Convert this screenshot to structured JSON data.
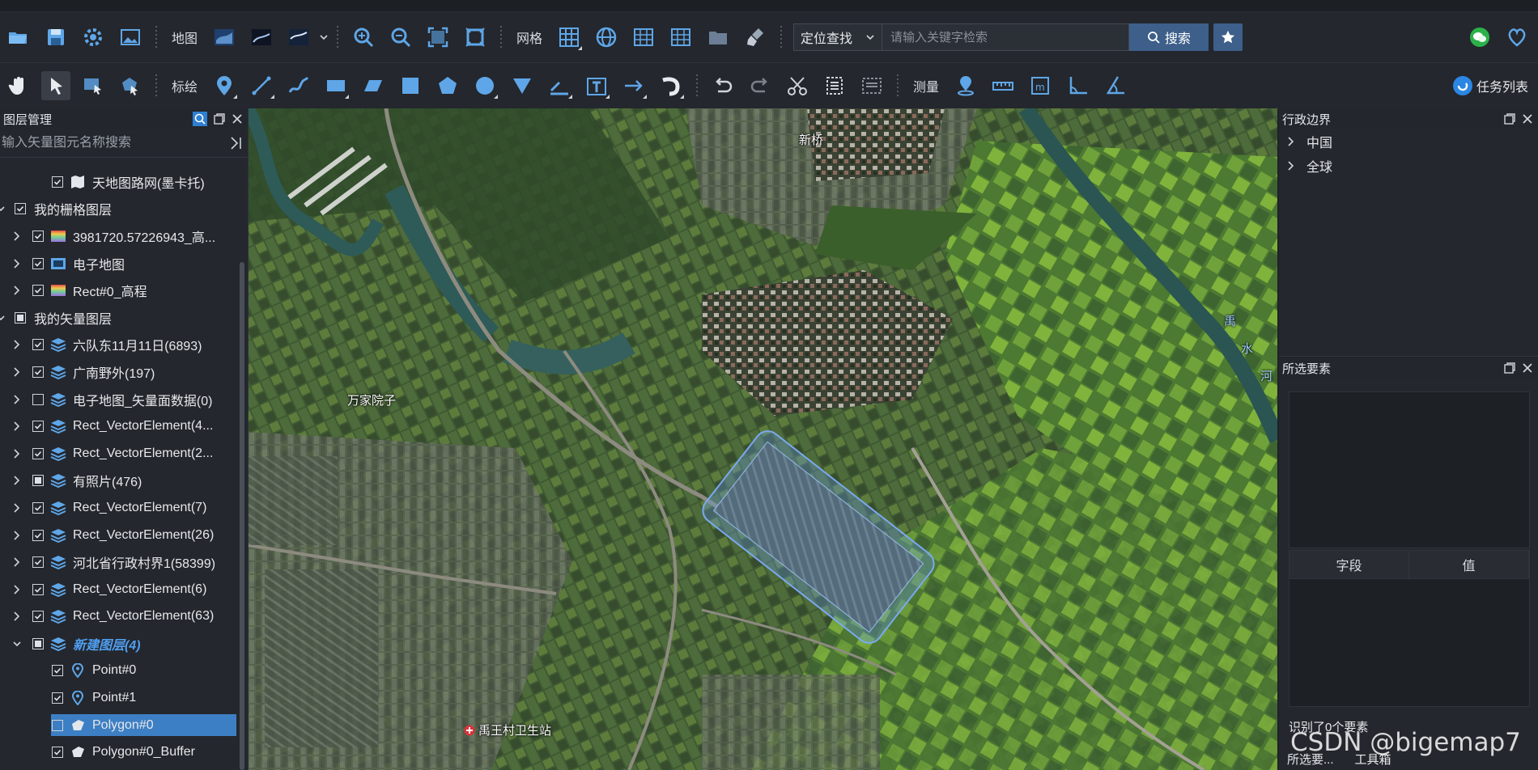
{
  "toolbar1": {
    "map_label": "地图",
    "grid_label": "网格",
    "location_select": "定位查找",
    "search_placeholder": "请输入关键字检索",
    "search_button": "搜索"
  },
  "toolbar2": {
    "draw_label": "标绘",
    "measure_label": "测量",
    "task_list": "任务列表"
  },
  "left_panel": {
    "title": "图层管理",
    "search_placeholder": "输入矢量图元名称搜索",
    "layers": [
      {
        "name": "天地图路网(墨卡托)",
        "level": 2,
        "expander": "none",
        "check": "checked",
        "icon": "map-book"
      },
      {
        "name": "我的栅格图层",
        "level": 0,
        "expander": "down",
        "check": "checked",
        "icon": "none"
      },
      {
        "name": "3981720.57226943_高...",
        "level": 1,
        "expander": "right",
        "check": "checked",
        "icon": "gradient"
      },
      {
        "name": "电子地图",
        "level": 1,
        "expander": "right",
        "check": "checked",
        "icon": "image"
      },
      {
        "name": "Rect#0_高程",
        "level": 1,
        "expander": "right",
        "check": "checked",
        "icon": "gradient"
      },
      {
        "name": "我的矢量图层",
        "level": 0,
        "expander": "down",
        "check": "partial",
        "icon": "none"
      },
      {
        "name": "六队东11月11日(6893)",
        "level": 1,
        "expander": "right",
        "check": "checked",
        "icon": "layers"
      },
      {
        "name": "广南野外(197)",
        "level": 1,
        "expander": "right",
        "check": "checked",
        "icon": "layers"
      },
      {
        "name": "电子地图_矢量面数据(0)",
        "level": 1,
        "expander": "right",
        "check": "unchecked",
        "icon": "layers"
      },
      {
        "name": "Rect_VectorElement(4...",
        "level": 1,
        "expander": "right",
        "check": "checked",
        "icon": "layers"
      },
      {
        "name": "Rect_VectorElement(2...",
        "level": 1,
        "expander": "right",
        "check": "checked",
        "icon": "layers"
      },
      {
        "name": "有照片(476)",
        "level": 1,
        "expander": "right",
        "check": "partial",
        "icon": "layers"
      },
      {
        "name": "Rect_VectorElement(7)",
        "level": 1,
        "expander": "right",
        "check": "checked",
        "icon": "layers"
      },
      {
        "name": "Rect_VectorElement(26)",
        "level": 1,
        "expander": "right",
        "check": "checked",
        "icon": "layers"
      },
      {
        "name": "河北省行政村界1(58399)",
        "level": 1,
        "expander": "right",
        "check": "checked",
        "icon": "layers"
      },
      {
        "name": "Rect_VectorElement(6)",
        "level": 1,
        "expander": "right",
        "check": "checked",
        "icon": "layers"
      },
      {
        "name": "Rect_VectorElement(63)",
        "level": 1,
        "expander": "right",
        "check": "checked",
        "icon": "layers"
      },
      {
        "name": "新建图层(4)",
        "level": 1,
        "expander": "down",
        "check": "partial",
        "icon": "layers",
        "style": "italic-blue"
      },
      {
        "name": "Point#0",
        "level": 2,
        "expander": "none",
        "check": "checked",
        "icon": "pin"
      },
      {
        "name": "Point#1",
        "level": 2,
        "expander": "none",
        "check": "checked",
        "icon": "pin"
      },
      {
        "name": "Polygon#0",
        "level": 2,
        "expander": "none",
        "check": "unchecked",
        "icon": "polygon",
        "selected": true
      },
      {
        "name": "Polygon#0_Buffer",
        "level": 2,
        "expander": "none",
        "check": "checked",
        "icon": "polygon"
      }
    ]
  },
  "right_top": {
    "title": "行政边界",
    "items": [
      "中国",
      "全球"
    ]
  },
  "right_bottom": {
    "title": "所选要素",
    "col_field": "字段",
    "col_value": "值",
    "status": "识别了0个要素",
    "tab1": "所选要...",
    "tab2": "工具箱"
  },
  "map": {
    "labels": [
      "新桥",
      "万家院子",
      "禹王村卫生站"
    ],
    "river_label": [
      "禹",
      "水",
      "河"
    ]
  },
  "watermark": "CSDN @bigemap7",
  "colors": {
    "accent": "#3d7fc4",
    "selected_row": "#3d7fc4",
    "search_button": "#3d5f8a",
    "buffer_fill": "#6a9be8"
  }
}
